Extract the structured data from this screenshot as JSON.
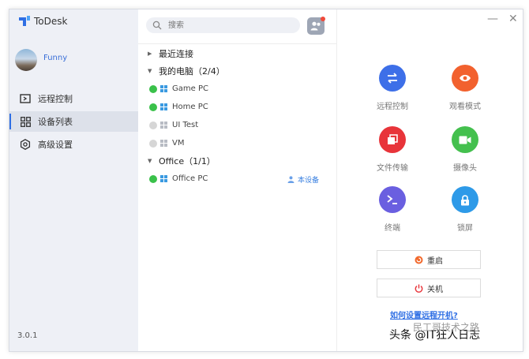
{
  "app": {
    "title": "ToDesk",
    "version": "3.0.1"
  },
  "user": {
    "name": "Funny"
  },
  "nav": [
    {
      "label": "远程控制",
      "icon": "remote-control-icon",
      "active": false
    },
    {
      "label": "设备列表",
      "icon": "device-grid-icon",
      "active": true
    },
    {
      "label": "高级设置",
      "icon": "settings-icon",
      "active": false
    }
  ],
  "search": {
    "placeholder": "搜索"
  },
  "tree": {
    "recent": {
      "label": "最近连接"
    },
    "my_devices": {
      "label": "我的电脑（2/4）",
      "devices": [
        {
          "name": "Game PC",
          "status": "online"
        },
        {
          "name": "Home PC",
          "status": "online"
        },
        {
          "name": "UI Test",
          "status": "offline"
        },
        {
          "name": "VM",
          "status": "offline"
        }
      ]
    },
    "office": {
      "label": "Office（1/1）",
      "devices": [
        {
          "name": "Office PC",
          "status": "online",
          "badge": "本设备"
        }
      ]
    }
  },
  "features": [
    {
      "label": "远程控制",
      "color": "#3d6fe8",
      "icon": "swap-arrows-icon"
    },
    {
      "label": "观看模式",
      "color": "#f2612e",
      "icon": "eye-icon"
    },
    {
      "label": "文件传输",
      "color": "#e8343a",
      "icon": "file-copy-icon"
    },
    {
      "label": "摄像头",
      "color": "#44c04e",
      "icon": "camera-icon"
    },
    {
      "label": "终端",
      "color": "#6a5fe0",
      "icon": "terminal-icon"
    },
    {
      "label": "锁屏",
      "color": "#2e9ae8",
      "icon": "lock-icon"
    }
  ],
  "actions": {
    "restart": "重启",
    "shutdown": "关机"
  },
  "help_link": "如何设置远程开机?",
  "watermark": {
    "main": "头条 @IT狂人日志",
    "sub": "民工哥技术之路"
  },
  "colors": {
    "accent": "#2f6fe4",
    "online": "#3ac14a",
    "offline": "#d6d6d6"
  }
}
